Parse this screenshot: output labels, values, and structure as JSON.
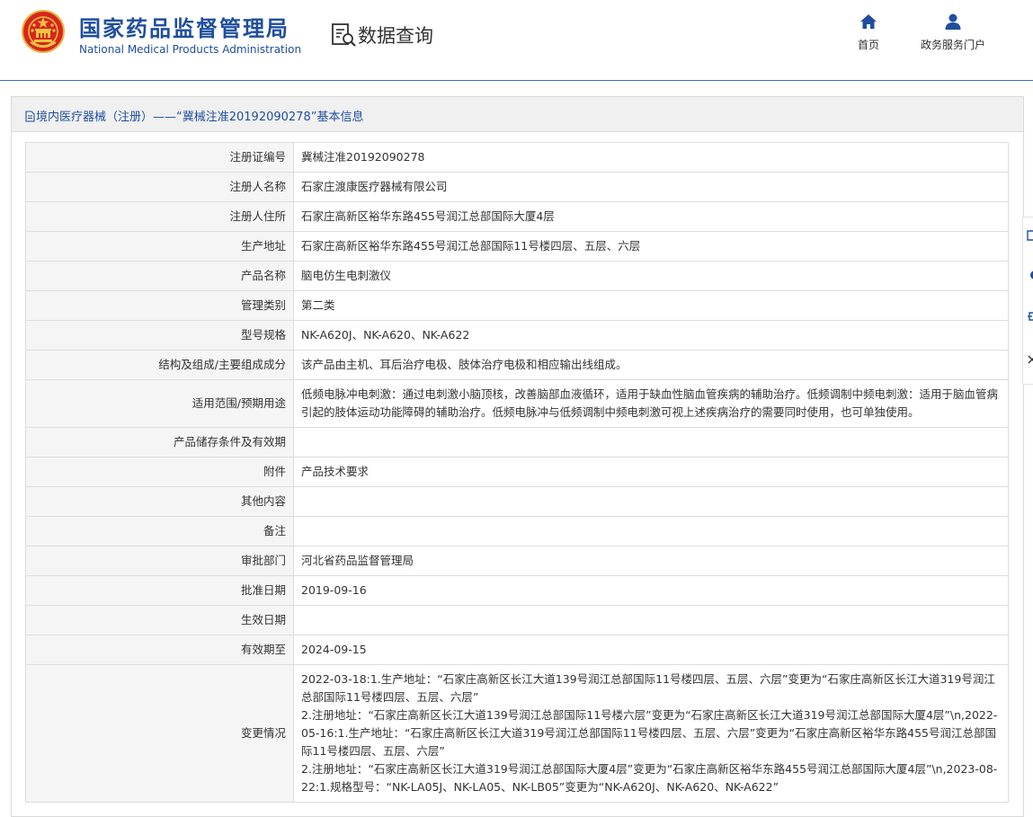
{
  "header": {
    "org_name_cn": "国家药品监督管理局",
    "org_name_en": "National Medical Products Administration",
    "query_label": "数据查询",
    "nav": [
      {
        "label": "首页",
        "icon": "home-icon"
      },
      {
        "label": "政务服务门户",
        "icon": "user-icon"
      }
    ],
    "accent_color": "#1f4e9e"
  },
  "panel": {
    "title": "境内医疗器械（注册）——“冀械注准20192090278”基本信息",
    "icon": "document-icon"
  },
  "details": {
    "rows": [
      {
        "label": "注册证编号",
        "value": "冀械注准20192090278"
      },
      {
        "label": "注册人名称",
        "value": "石家庄渡康医疗器械有限公司"
      },
      {
        "label": "注册人住所",
        "value": "石家庄高新区裕华东路455号润江总部国际大厦4层"
      },
      {
        "label": "生产地址",
        "value": "石家庄高新区裕华东路455号润江总部国际11号楼四层、五层、六层"
      },
      {
        "label": "产品名称",
        "value": "脑电仿生电刺激仪"
      },
      {
        "label": "管理类别",
        "value": "第二类"
      },
      {
        "label": "型号规格",
        "value": "NK-A620J、NK-A620、NK-A622"
      },
      {
        "label": "结构及组成/主要组成成分",
        "value": "该产品由主机、耳后治疗电极、肢体治疗电极和相应输出线组成。"
      },
      {
        "label": "适用范围/预期用途",
        "value": "低频电脉冲电刺激：通过电刺激小脑顶核，改善脑部血液循环，适用于缺血性脑血管疾病的辅助治疗。低频调制中频电刺激：适用于脑血管病引起的肢体运动功能障碍的辅助治疗。低频电脉冲与低频调制中频电刺激可视上述疾病治疗的需要同时使用，也可单独使用。"
      },
      {
        "label": "产品储存条件及有效期",
        "value": ""
      },
      {
        "label": "附件",
        "value": "产品技术要求"
      },
      {
        "label": "其他内容",
        "value": ""
      },
      {
        "label": "备注",
        "value": ""
      },
      {
        "label": "审批部门",
        "value": "河北省药品监督管理局"
      },
      {
        "label": "批准日期",
        "value": "2019-09-16"
      },
      {
        "label": "生效日期",
        "value": ""
      },
      {
        "label": "有效期至",
        "value": "2024-09-15"
      }
    ],
    "change_row": {
      "label": "变更情况",
      "lines": [
        "2022-03-18:1.生产地址：“石家庄高新区长江大道139号润江总部国际11号楼四层、五层、六层”变更为“石家庄高新区长江大道319号润江总部国际11号楼四层、五层、六层”",
        "2.注册地址：“石家庄高新区长江大道139号润江总部国际11号楼六层”变更为“石家庄高新区长江大道319号润江总部国际大厦4层”\\n,2022-05-16:1.生产地址：“石家庄高新区长江大道319号润江总部国际11号楼四层、五层、六层”变更为“石家庄高新区裕华东路455号润江总部国际11号楼四层、五层、六层”",
        "2.注册地址：“石家庄高新区长江大道319号润江总部国际大厦4层”变更为“石家庄高新区裕华东路455号润江总部国际大厦4层”\\n,2023-08-22:1.规格型号：“NK-LA05J、NK-LA05、NK-LB05”变更为“NK-A620J、NK-A620、NK-A622”"
      ]
    }
  }
}
